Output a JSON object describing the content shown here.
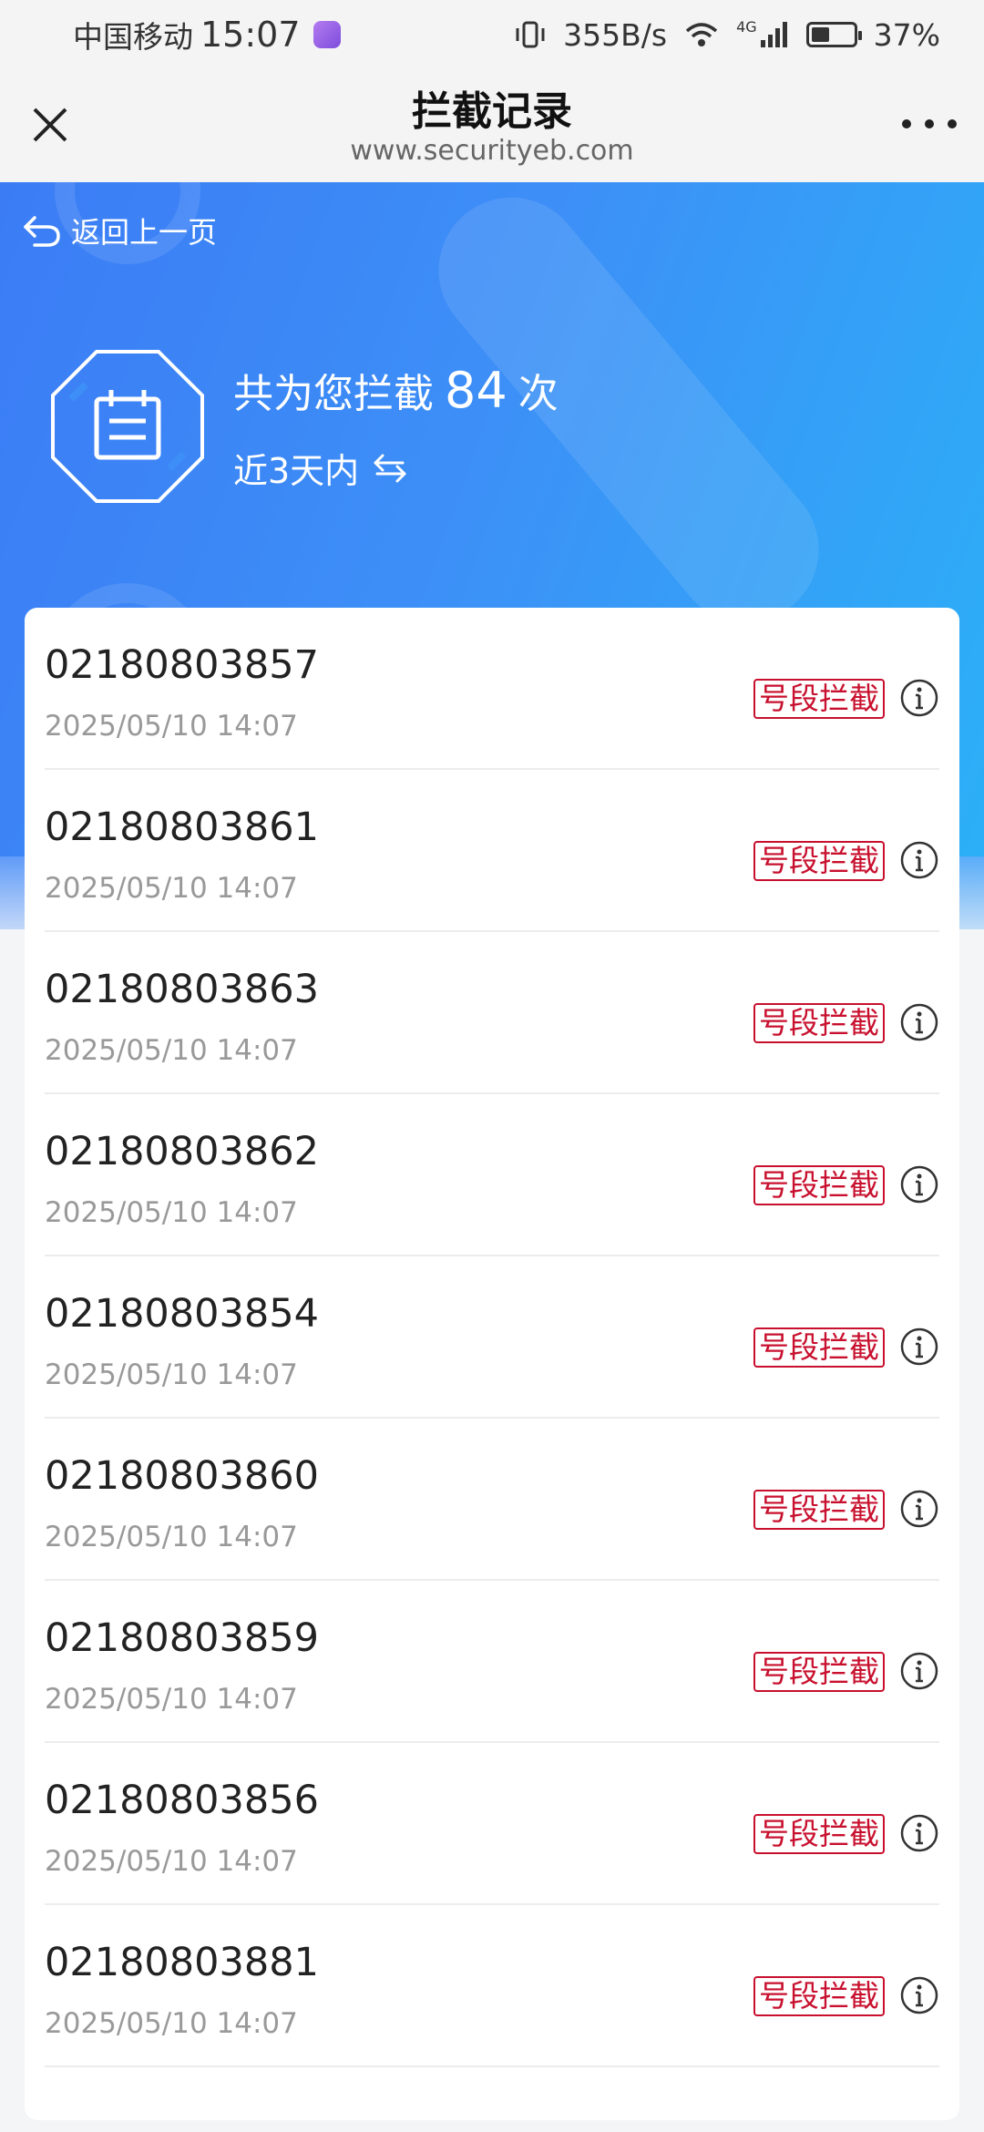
{
  "status_bar": {
    "carrier": "中国移动",
    "time": "15:07",
    "net_speed": "355B/s",
    "network": "4G",
    "battery": "37%"
  },
  "header": {
    "title": "拦截记录",
    "url": "www.securityeb.com"
  },
  "hero": {
    "back_label": "返回上一页",
    "count_prefix": "共为您拦截",
    "count": "84",
    "count_suffix": "次",
    "range_label": "近3天内"
  },
  "records": [
    {
      "number": "02180803857",
      "time": "2025/05/10 14:07",
      "tag": "号段拦截"
    },
    {
      "number": "02180803861",
      "time": "2025/05/10 14:07",
      "tag": "号段拦截"
    },
    {
      "number": "02180803863",
      "time": "2025/05/10 14:07",
      "tag": "号段拦截"
    },
    {
      "number": "02180803862",
      "time": "2025/05/10 14:07",
      "tag": "号段拦截"
    },
    {
      "number": "02180803854",
      "time": "2025/05/10 14:07",
      "tag": "号段拦截"
    },
    {
      "number": "02180803860",
      "time": "2025/05/10 14:07",
      "tag": "号段拦截"
    },
    {
      "number": "02180803859",
      "time": "2025/05/10 14:07",
      "tag": "号段拦截"
    },
    {
      "number": "02180803856",
      "time": "2025/05/10 14:07",
      "tag": "号段拦截"
    },
    {
      "number": "02180803881",
      "time": "2025/05/10 14:07",
      "tag": "号段拦截"
    }
  ],
  "colors": {
    "hero_start": "#3b7cf5",
    "hero_end": "#2bb1f7",
    "tag_red": "#c8102e"
  },
  "icons": {
    "close": "close-icon",
    "more": "more-icon",
    "back": "back-arrow-icon",
    "shield": "octagon-calendar-icon",
    "switch": "switch-arrows-icon",
    "info": "info-icon"
  }
}
